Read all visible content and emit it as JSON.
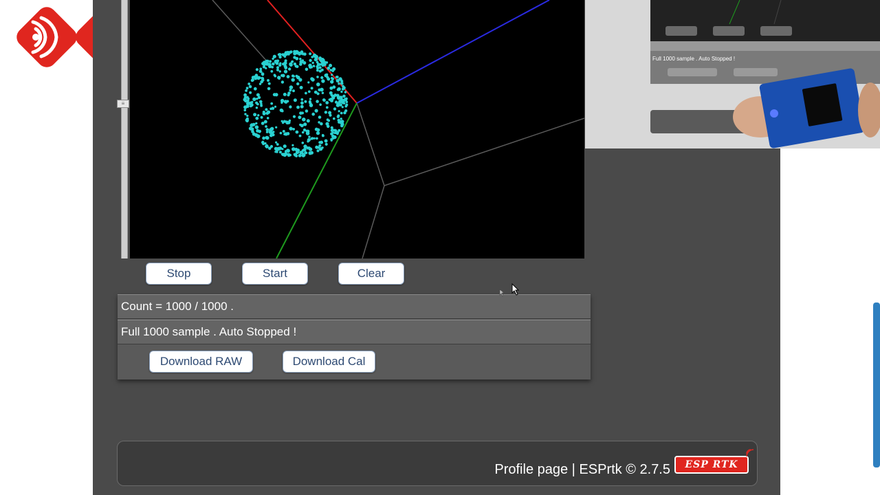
{
  "controls": {
    "stop_label": "Stop",
    "start_label": "Start",
    "clear_label": "Clear"
  },
  "status": {
    "count_text": "Count = 1000 / 1000 .",
    "message_text": "Full 1000 sample . Auto Stopped !",
    "download_raw_label": "Download RAW",
    "download_cal_label": "Download Cal"
  },
  "footer": {
    "text": "Profile page | ESPrtk © 2.7.5",
    "logo_text": "ESP RTK"
  },
  "overlay": {
    "status_line": "Full 1000 sample . Auto Stopped !"
  },
  "icons": {
    "brand_logo": "espressif-logo-icon",
    "footer_logo": "esprtk-logo-icon",
    "cursor": "mouse-cursor-icon"
  },
  "colors": {
    "point_cloud": "#2ad1d1",
    "axis_x": "#e02020",
    "axis_y": "#2a2ae0",
    "axis_z": "#1e9a1e",
    "grid": "#5a5a5a",
    "brand_red": "#e0261f"
  }
}
